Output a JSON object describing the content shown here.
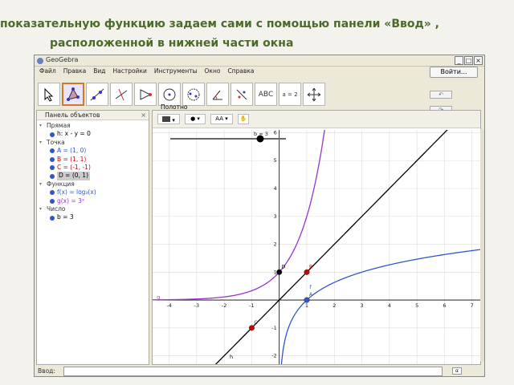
{
  "caption": {
    "line1": "показательную функцию задаем сами   с помощью панели  «Ввод» ,",
    "line2": "расположенной в нижней части окна"
  },
  "window": {
    "title": "GeoGebra",
    "buttons": [
      "_",
      "□",
      "×"
    ]
  },
  "menu": [
    "Файл",
    "Правка",
    "Вид",
    "Настройки",
    "Инструменты",
    "Окно",
    "Справка"
  ],
  "login_label": "Войти...",
  "toolbar": {
    "tools": [
      "move-tool",
      "polygon-tool",
      "line-tool",
      "perpendicular-tool",
      "triangle-tool",
      "circle-tool",
      "conic-tool",
      "angle-tool",
      "reflect-tool",
      "text-tool",
      "slider-tool",
      "move-graphics-tool"
    ],
    "text_tool_label": "ABC",
    "slider_tool_label": "a = 2"
  },
  "undo": {
    "undo_label": "↶",
    "redo_label": "↷",
    "help": "?",
    "settings": "✥"
  },
  "algebra_panel": {
    "header": "Панель объектов",
    "categories": [
      {
        "name": "Прямая",
        "items": [
          {
            "text": "h: x - y = 0",
            "color": "#000000"
          }
        ]
      },
      {
        "name": "Точка",
        "items": [
          {
            "text": "A = (1, 0)",
            "color": "#3355cc"
          },
          {
            "text": "B = (1, 1)",
            "color": "#cc0000"
          },
          {
            "text": "C = (-1, -1)",
            "color": "#cc0000"
          },
          {
            "text": "D = (0, 1)",
            "color": "#000000"
          }
        ]
      },
      {
        "name": "Функция",
        "items": [
          {
            "text": "f(x) = log₃(x)",
            "color": "#3355cc"
          },
          {
            "text": "g(x) = 3ˣ",
            "color": "#9933cc"
          }
        ]
      },
      {
        "name": "Число",
        "items": [
          {
            "text": "b = 3",
            "color": "#000000"
          }
        ]
      }
    ]
  },
  "graphics_panel": {
    "header": "Полотно",
    "slider_label": "b = 3"
  },
  "input_bar": {
    "label": "Ввод:",
    "value": "",
    "help_label": "α"
  },
  "chart_data": {
    "type": "line",
    "xlim": [
      -4.6,
      7.3
    ],
    "ylim": [
      -2.3,
      6.1
    ],
    "x_ticks": [
      -4,
      -3,
      -2,
      -1,
      1,
      2,
      3,
      4,
      5,
      6,
      7
    ],
    "y_ticks": [
      -2,
      -1,
      1,
      2,
      3,
      4,
      5,
      6
    ],
    "grid": true,
    "series": [
      {
        "name": "g",
        "color": "#9933cc",
        "base": 3,
        "kind": "exp"
      },
      {
        "name": "f",
        "color": "#3355cc",
        "base": 3,
        "kind": "log"
      },
      {
        "name": "h",
        "color": "#000000",
        "kind": "identity"
      }
    ],
    "points": [
      {
        "name": "A",
        "x": 1,
        "y": 0,
        "color": "#3355cc"
      },
      {
        "name": "B",
        "x": 1,
        "y": 1,
        "color": "#cc0000"
      },
      {
        "name": "C",
        "x": -1,
        "y": -1,
        "color": "#cc0000"
      },
      {
        "name": "D",
        "x": 0,
        "y": 1,
        "color": "#000000"
      }
    ]
  }
}
